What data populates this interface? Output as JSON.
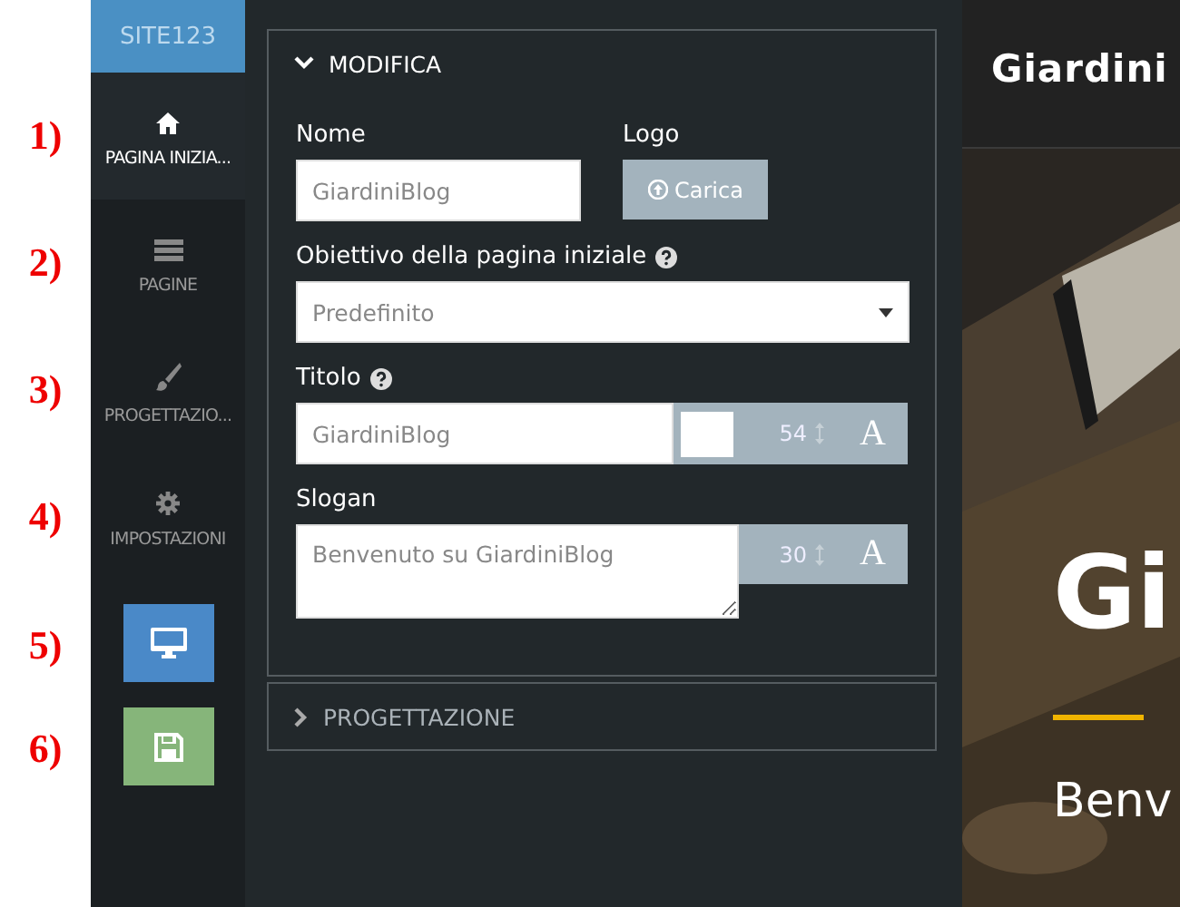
{
  "sidebar": {
    "logo": "SITE123",
    "items": [
      {
        "kind": "home",
        "label": "PAGINA INIZIA...",
        "selected": true,
        "annotation": "1)"
      },
      {
        "kind": "pages",
        "label": "PAGINE",
        "selected": false,
        "annotation": "2)"
      },
      {
        "kind": "design",
        "label": "PROGETTAZIO...",
        "selected": false,
        "annotation": "3)"
      },
      {
        "kind": "settings",
        "label": "IMPOSTAZIONI",
        "selected": false,
        "annotation": "4)"
      },
      {
        "kind": "preview",
        "annotation": "5)"
      },
      {
        "kind": "save",
        "annotation": "6)"
      }
    ]
  },
  "sections": [
    {
      "title": "MODIFICA",
      "expanded": true,
      "fields": {
        "name": {
          "label": "Nome",
          "value": "GiardiniBlog"
        },
        "logo": {
          "label": "Logo",
          "button": "Carica"
        },
        "goal": {
          "label": "Obiettivo della pagina iniziale",
          "value": "Predefinito"
        },
        "title": {
          "label": "Titolo",
          "value": "GiardiniBlog",
          "size": "54",
          "font_button": "A"
        },
        "slogan": {
          "label": "Slogan",
          "value": "Benvenuto su GiardiniBlog",
          "size": "30",
          "font_button": "A"
        }
      }
    },
    {
      "title": "PROGETTAZIONE",
      "expanded": false
    }
  ],
  "preview": {
    "header_title": "Giardini",
    "hero_title": "Gi",
    "hero_subtitle": "Benv"
  }
}
